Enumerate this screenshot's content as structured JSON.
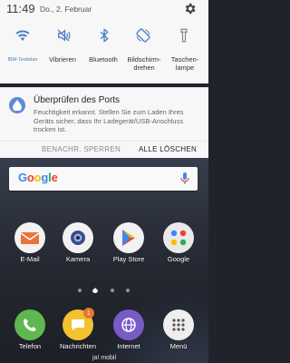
{
  "status": {
    "time": "11:49",
    "date": "Do., 2. Februar",
    "settings_icon": "gear-icon"
  },
  "quick_settings": {
    "toggles": [
      {
        "icon": "wifi-icon",
        "label": "IBM-Testwlan"
      },
      {
        "icon": "vibrate-icon",
        "label": "Vibrieren"
      },
      {
        "icon": "bluetooth-icon",
        "label": "Bluetooth"
      },
      {
        "icon": "screen-rotation-icon",
        "label": "Bildschirm-\ndrehen"
      },
      {
        "icon": "flashlight-icon",
        "label": "Taschen-\nlampe"
      }
    ],
    "accent_color": "#4a7fc1"
  },
  "notification": {
    "icon": "water-drop-icon",
    "title": "Überprüfen des Ports",
    "body": "Feuchtigkeit erkannt. Stellen Sie zum Laden Ihres Geräts sicher, dass Ihr Ladegerät/USB-Anschluss trocken ist.",
    "actions": {
      "block": "BENACHR. SPERREN",
      "clear_all": "ALLE LÖSCHEN"
    }
  },
  "search_bar": {
    "logo_text": "Google",
    "mic_icon": "mic-icon"
  },
  "apps": [
    {
      "label": "E-Mail",
      "icon": "mail-icon"
    },
    {
      "label": "Kamera",
      "icon": "camera-icon"
    },
    {
      "label": "Play Store",
      "icon": "play-store-icon"
    },
    {
      "label": "Google",
      "icon": "google-folder-icon"
    }
  ],
  "dock": [
    {
      "label": "Telefon",
      "icon": "phone-icon"
    },
    {
      "label": "Nachrichten",
      "icon": "messages-icon",
      "badge": "1"
    },
    {
      "label": "Internet",
      "icon": "internet-icon"
    },
    {
      "label": "Menü",
      "icon": "apps-menu-icon"
    }
  ],
  "carrier": "ja! mobil"
}
